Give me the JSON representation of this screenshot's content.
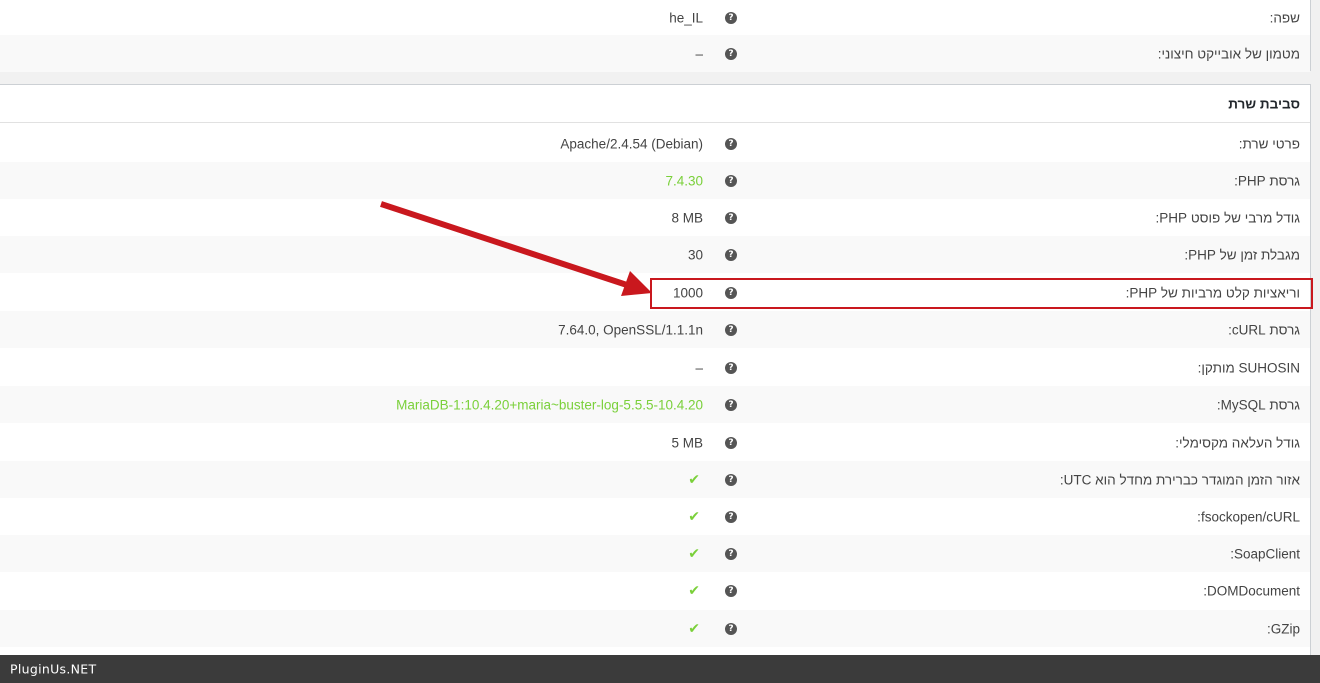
{
  "top_section": {
    "rows": [
      {
        "label": "שפה:",
        "value": "he_IL"
      },
      {
        "label": "מטמון של אובייקט חיצוני:",
        "value": "–"
      }
    ]
  },
  "server_section": {
    "title": "סביבת שרת",
    "rows": [
      {
        "label": "פרטי שרת:",
        "value": "Apache/2.4.54 (Debian)"
      },
      {
        "label": "גרסת PHP:",
        "value": "7.4.30"
      },
      {
        "label": "גודל מרבי של פוסט PHP:",
        "value": "8 MB"
      },
      {
        "label": "מגבלת זמן של PHP:",
        "value": "30"
      },
      {
        "label": "וריאציות קלט מרביות של PHP:",
        "value": "1000"
      },
      {
        "label": "גרסת cURL:",
        "value": "7.64.0, OpenSSL/1.1.1n"
      },
      {
        "label": "SUHOSIN מותקן:",
        "value": "–"
      },
      {
        "label": "גרסת MySQL:",
        "value": "MariaDB-1:10.4.20+maria~buster-log-5.5.5-10.4.20"
      },
      {
        "label": "גודל העלאה מקסימלי:",
        "value": "5 MB"
      },
      {
        "label": "אזור הזמן המוגדר כברירת מחדל הוא UTC:",
        "value": "✔"
      },
      {
        "label": "fsockopen/cURL:",
        "value": "✔"
      },
      {
        "label": "SoapClient:",
        "value": "✔"
      },
      {
        "label": "DOMDocument:",
        "value": "✔"
      },
      {
        "label": "GZip:",
        "value": "✔"
      }
    ]
  },
  "help_icon_glyph": "?",
  "footer": {
    "text": "PluginUs.NET"
  },
  "colors": {
    "ok_green": "#7ad03a",
    "annotation_red": "#c9181e"
  }
}
